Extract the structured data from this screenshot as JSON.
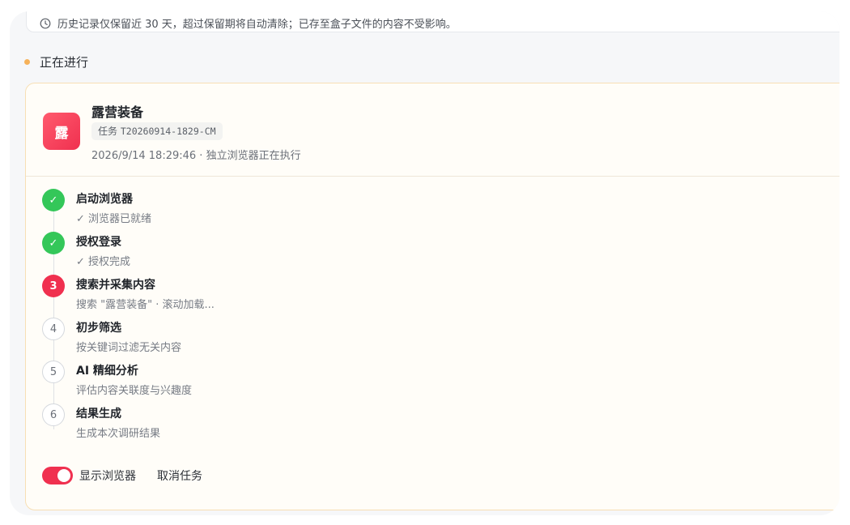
{
  "notice": {
    "icon": "clock-icon",
    "text": "历史记录仅保留近 30 天，超过保留期将自动清除；已存至盒子文件的内容不受影响。"
  },
  "section": {
    "title": "正在进行",
    "dot_color": "#f6b25a"
  },
  "task": {
    "icon_char": "露",
    "title": "露营装备",
    "id_label": "任务",
    "id_value": "T20260914-1829-CM",
    "meta": "2026/9/14 18:29:46 · 独立浏览器正在执行",
    "accent": "#f0304f"
  },
  "steps": [
    {
      "badge": "✓",
      "state": "done",
      "title": "启动浏览器",
      "desc": "✓ 浏览器已就绪"
    },
    {
      "badge": "✓",
      "state": "done",
      "title": "授权登录",
      "desc": "✓ 授权完成"
    },
    {
      "badge": "3",
      "state": "active",
      "title": "搜索并采集内容",
      "desc": "搜索 \"露营装备\" · 滚动加载..."
    },
    {
      "badge": "4",
      "state": "todo",
      "title": "初步筛选",
      "desc": "按关键词过滤无关内容"
    },
    {
      "badge": "5",
      "state": "todo",
      "title": "AI 精细分析",
      "desc": "评估内容关联度与兴趣度"
    },
    {
      "badge": "6",
      "state": "todo",
      "title": "结果生成",
      "desc": "生成本次调研结果"
    }
  ],
  "footer": {
    "toggle_label": "显示浏览器",
    "toggle_on": true,
    "cancel_label": "取消任务"
  }
}
